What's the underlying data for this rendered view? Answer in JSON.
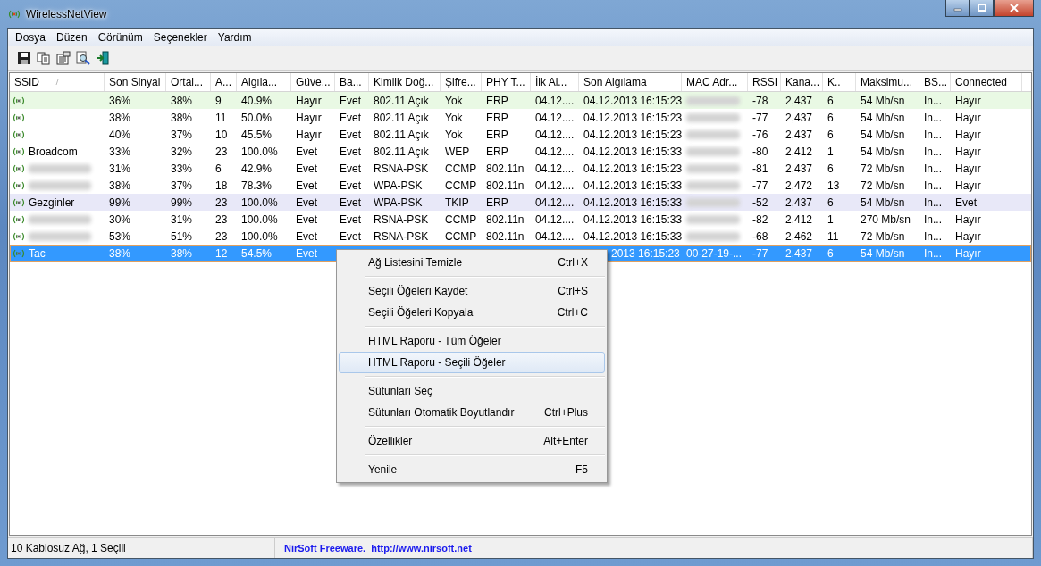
{
  "window": {
    "title": "WirelessNetView"
  },
  "menu_bar": [
    "Dosya",
    "Düzen",
    "Görünüm",
    "Seçenekler",
    "Yardım"
  ],
  "toolbar": [
    {
      "kind": "save"
    },
    {
      "kind": "copy"
    },
    {
      "kind": "properties"
    },
    {
      "kind": "find"
    },
    {
      "kind": "exit"
    }
  ],
  "table": {
    "columns": [
      "SSID",
      "Son Sinyal",
      "Ortal...",
      "A...",
      "Algıla...",
      "Güve...",
      "Ba...",
      "Kimlik Doğ...",
      "Şifre...",
      "PHY T...",
      "İlk Al...",
      "Son Algılama",
      "MAC Adr...",
      "RSSI",
      "Kana...",
      "K..",
      "Maksimu...",
      "BS...",
      "Connected"
    ],
    "rows": [
      {
        "ssid_blurred": false,
        "mac_blurred": true,
        "color": "#e9f9e4",
        "selected": false,
        "clipped_last_seen": false,
        "cells": [
          "",
          "36%",
          "38%",
          "9",
          "40.9%",
          "Hayır",
          "Evet",
          "802.11 Açık",
          "Yok",
          "ERP",
          "04.12....",
          "04.12.2013 16:15:23",
          null,
          "-78",
          "2,437",
          "6",
          "54 Mb/sn",
          "In...",
          "Hayır"
        ]
      },
      {
        "ssid_blurred": false,
        "mac_blurred": true,
        "selected": false,
        "clipped_last_seen": false,
        "cells": [
          "",
          "38%",
          "38%",
          "11",
          "50.0%",
          "Hayır",
          "Evet",
          "802.11 Açık",
          "Yok",
          "ERP",
          "04.12....",
          "04.12.2013 16:15:23",
          null,
          "-77",
          "2,437",
          "6",
          "54 Mb/sn",
          "In...",
          "Hayır"
        ]
      },
      {
        "ssid_blurred": false,
        "mac_blurred": true,
        "selected": false,
        "clipped_last_seen": false,
        "cells": [
          "",
          "40%",
          "37%",
          "10",
          "45.5%",
          "Hayır",
          "Evet",
          "802.11 Açık",
          "Yok",
          "ERP",
          "04.12....",
          "04.12.2013 16:15:23",
          null,
          "-76",
          "2,437",
          "6",
          "54 Mb/sn",
          "In...",
          "Hayır"
        ]
      },
      {
        "ssid_blurred": false,
        "mac_blurred": true,
        "selected": false,
        "clipped_last_seen": false,
        "cells": [
          "Broadcom",
          "33%",
          "32%",
          "23",
          "100.0%",
          "Evet",
          "Evet",
          "802.11 Açık",
          "WEP",
          "ERP",
          "04.12....",
          "04.12.2013 16:15:33",
          null,
          "-80",
          "2,412",
          "1",
          "54 Mb/sn",
          "In...",
          "Hayır"
        ]
      },
      {
        "ssid_blurred": true,
        "mac_blurred": true,
        "selected": false,
        "clipped_last_seen": false,
        "cells": [
          "",
          "31%",
          "33%",
          "6",
          "42.9%",
          "Evet",
          "Evet",
          "RSNA-PSK",
          "CCMP",
          "802.11n",
          "04.12....",
          "04.12.2013 16:15:23",
          null,
          "-81",
          "2,437",
          "6",
          "72 Mb/sn",
          "In...",
          "Hayır"
        ]
      },
      {
        "ssid_blurred": true,
        "mac_blurred": true,
        "selected": false,
        "clipped_last_seen": false,
        "cells": [
          "",
          "38%",
          "37%",
          "18",
          "78.3%",
          "Evet",
          "Evet",
          "WPA-PSK",
          "CCMP",
          "802.11n",
          "04.12....",
          "04.12.2013 16:15:33",
          null,
          "-77",
          "2,472",
          "13",
          "72 Mb/sn",
          "In...",
          "Hayır"
        ]
      },
      {
        "ssid_blurred": false,
        "mac_blurred": true,
        "color": "#e8e8f8",
        "selected": false,
        "clipped_last_seen": false,
        "cells": [
          "Gezginler",
          "99%",
          "99%",
          "23",
          "100.0%",
          "Evet",
          "Evet",
          "WPA-PSK",
          "TKIP",
          "ERP",
          "04.12....",
          "04.12.2013 16:15:33",
          null,
          "-52",
          "2,437",
          "6",
          "54 Mb/sn",
          "In...",
          "Evet"
        ]
      },
      {
        "ssid_blurred": true,
        "mac_blurred": true,
        "selected": false,
        "clipped_last_seen": false,
        "cells": [
          "",
          "30%",
          "31%",
          "23",
          "100.0%",
          "Evet",
          "Evet",
          "RSNA-PSK",
          "CCMP",
          "802.11n",
          "04.12....",
          "04.12.2013 16:15:33",
          null,
          "-82",
          "2,412",
          "1",
          "270 Mb/sn",
          "In...",
          "Hayır"
        ]
      },
      {
        "ssid_blurred": true,
        "mac_blurred": true,
        "selected": false,
        "clipped_last_seen": false,
        "cells": [
          "",
          "53%",
          "51%",
          "23",
          "100.0%",
          "Evet",
          "Evet",
          "RSNA-PSK",
          "CCMP",
          "802.11n",
          "04.12....",
          "04.12.2013 16:15:33",
          null,
          "-68",
          "2,462",
          "11",
          "72 Mb/sn",
          "In...",
          "Hayır"
        ]
      },
      {
        "ssid_blurred": false,
        "mac_blurred": false,
        "selected": true,
        "clipped_last_seen": true,
        "cells": [
          "Tac",
          "38%",
          "38%",
          "12",
          "54.5%",
          "Evet",
          "",
          "",
          "",
          "",
          "",
          "2013 16:15:23",
          "00-27-19-...",
          "-77",
          "2,437",
          "6",
          "54 Mb/sn",
          "In...",
          "Hayır"
        ]
      }
    ]
  },
  "context_menu": [
    {
      "kind": "item",
      "label": "Ağ Listesini Temizle",
      "shortcut": "Ctrl+X",
      "selected": false
    },
    {
      "kind": "separator"
    },
    {
      "kind": "item",
      "label": "Seçili Öğeleri Kaydet",
      "shortcut": "Ctrl+S",
      "selected": false
    },
    {
      "kind": "item",
      "label": "Seçili Öğeleri Kopyala",
      "shortcut": "Ctrl+C",
      "selected": false
    },
    {
      "kind": "separator"
    },
    {
      "kind": "item",
      "label": "HTML Raporu - Tüm Öğeler",
      "selected": false
    },
    {
      "kind": "item",
      "label": "HTML Raporu - Seçili Öğeler",
      "selected": true
    },
    {
      "kind": "separator"
    },
    {
      "kind": "item",
      "label": "Sütunları Seç",
      "selected": false
    },
    {
      "kind": "item",
      "label": "Sütunları Otomatik Boyutlandır",
      "shortcut": "Ctrl+Plus",
      "selected": false
    },
    {
      "kind": "separator"
    },
    {
      "kind": "item",
      "label": "Özellikler",
      "shortcut": "Alt+Enter",
      "selected": false
    },
    {
      "kind": "separator"
    },
    {
      "kind": "item",
      "label": "Yenile",
      "shortcut": "F5",
      "selected": false
    }
  ],
  "status_bar": {
    "summary": "10 Kablosuz Ağ, 1 Seçili",
    "credit": "NirSoft Freeware.  http://www.nirsoft.net"
  }
}
